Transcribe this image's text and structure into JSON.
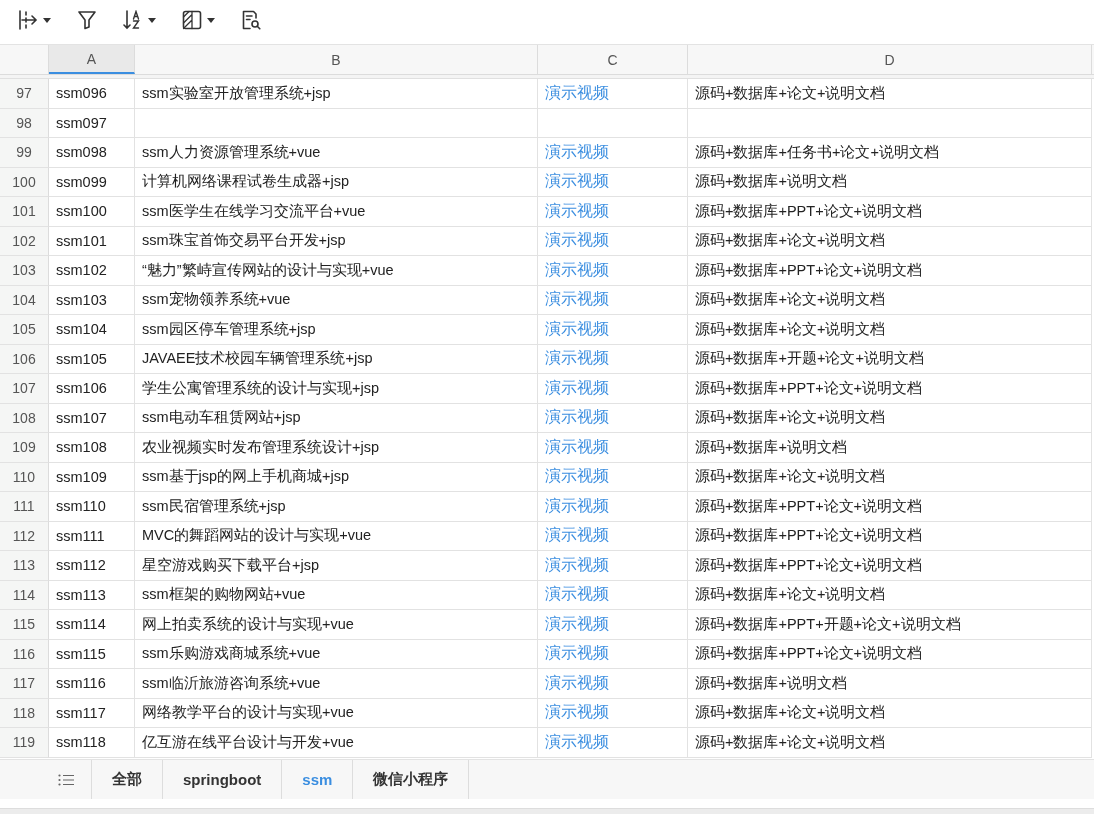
{
  "table": {
    "columns": [
      {
        "label": "A",
        "selected": true,
        "kind": "text"
      },
      {
        "label": "B",
        "selected": false,
        "kind": "text"
      },
      {
        "label": "C",
        "selected": false,
        "kind": "link"
      },
      {
        "label": "D",
        "selected": false,
        "kind": "text"
      }
    ],
    "rows": [
      {
        "number": "97",
        "cells": [
          "ssm096",
          "ssm实验室开放管理系统+jsp",
          "演示视频",
          "源码+数据库+论文+说明文档"
        ]
      },
      {
        "number": "98",
        "cells": [
          "ssm097"
        ]
      },
      {
        "number": "99",
        "cells": [
          "ssm098",
          "ssm人力资源管理系统+vue",
          "演示视频",
          "源码+数据库+任务书+论文+说明文档"
        ]
      },
      {
        "number": "100",
        "cells": [
          "ssm099",
          "计算机网络课程试卷生成器+jsp",
          "演示视频",
          "源码+数据库+说明文档"
        ]
      },
      {
        "number": "101",
        "cells": [
          "ssm100",
          "ssm医学生在线学习交流平台+vue",
          "演示视频",
          "源码+数据库+PPT+论文+说明文档"
        ]
      },
      {
        "number": "102",
        "cells": [
          "ssm101",
          "ssm珠宝首饰交易平台开发+jsp",
          "演示视频",
          "源码+数据库+论文+说明文档"
        ]
      },
      {
        "number": "103",
        "cells": [
          "ssm102",
          "“魅力”繁峙宣传网站的设计与实现+vue",
          "演示视频",
          "源码+数据库+PPT+论文+说明文档"
        ]
      },
      {
        "number": "104",
        "cells": [
          "ssm103",
          "ssm宠物领养系统+vue",
          "演示视频",
          "源码+数据库+论文+说明文档"
        ]
      },
      {
        "number": "105",
        "cells": [
          "ssm104",
          "ssm园区停车管理系统+jsp",
          "演示视频",
          "源码+数据库+论文+说明文档"
        ]
      },
      {
        "number": "106",
        "cells": [
          "ssm105",
          "JAVAEE技术校园车辆管理系统+jsp",
          "演示视频",
          "源码+数据库+开题+论文+说明文档"
        ]
      },
      {
        "number": "107",
        "cells": [
          "ssm106",
          "学生公寓管理系统的设计与实现+jsp",
          "演示视频",
          "源码+数据库+PPT+论文+说明文档"
        ]
      },
      {
        "number": "108",
        "cells": [
          "ssm107",
          "ssm电动车租赁网站+jsp",
          "演示视频",
          "源码+数据库+论文+说明文档"
        ]
      },
      {
        "number": "109",
        "cells": [
          "ssm108",
          "农业视频实时发布管理系统设计+jsp",
          "演示视频",
          "源码+数据库+说明文档"
        ]
      },
      {
        "number": "110",
        "cells": [
          "ssm109",
          "ssm基于jsp的网上手机商城+jsp",
          "演示视频",
          "源码+数据库+论文+说明文档"
        ]
      },
      {
        "number": "111",
        "cells": [
          "ssm110",
          "ssm民宿管理系统+jsp",
          "演示视频",
          "源码+数据库+PPT+论文+说明文档"
        ]
      },
      {
        "number": "112",
        "cells": [
          "ssm111",
          "MVC的舞蹈网站的设计与实现+vue",
          "演示视频",
          "源码+数据库+PPT+论文+说明文档"
        ]
      },
      {
        "number": "113",
        "cells": [
          "ssm112",
          "星空游戏购买下载平台+jsp",
          "演示视频",
          "源码+数据库+PPT+论文+说明文档"
        ]
      },
      {
        "number": "114",
        "cells": [
          "ssm113",
          "ssm框架的购物网站+vue",
          "演示视频",
          "源码+数据库+论文+说明文档"
        ]
      },
      {
        "number": "115",
        "cells": [
          "ssm114",
          "网上拍卖系统的设计与实现+vue",
          "演示视频",
          "源码+数据库+PPT+开题+论文+说明文档"
        ]
      },
      {
        "number": "116",
        "cells": [
          "ssm115",
          "ssm乐购游戏商城系统+vue",
          "演示视频",
          "源码+数据库+PPT+论文+说明文档"
        ]
      },
      {
        "number": "117",
        "cells": [
          "ssm116",
          "ssm临沂旅游咨询系统+vue",
          "演示视频",
          "源码+数据库+说明文档"
        ]
      },
      {
        "number": "118",
        "cells": [
          "ssm117",
          "网络教学平台的设计与实现+vue",
          "演示视频",
          "源码+数据库+论文+说明文档"
        ]
      },
      {
        "number": "119",
        "cells": [
          "ssm118",
          "亿互游在线平台设计与开发+vue",
          "演示视频",
          "源码+数据库+论文+说明文档"
        ]
      }
    ]
  },
  "sheet_tabs": [
    {
      "label": "全部",
      "selected": false
    },
    {
      "label": "springboot",
      "selected": false
    },
    {
      "label": "ssm",
      "selected": true
    },
    {
      "label": "微信小程序",
      "selected": false
    }
  ]
}
